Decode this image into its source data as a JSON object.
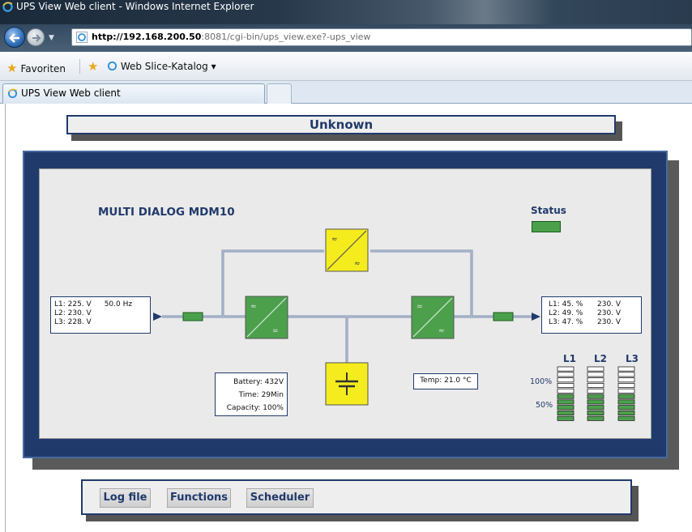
{
  "browser": {
    "window_title": "UPS View Web client - Windows Internet Explorer",
    "url_host": "http://192.168.200.50",
    "url_rest": ":8081/cgi-bin/ups_view.exe?-ups_view",
    "favorites_label": "Favoriten",
    "web_slice_label": "Web Slice-Katalog ▾",
    "tab_label": "UPS View Web client"
  },
  "page": {
    "status_header": "Unknown",
    "model": "MULTI DIALOG MDM10",
    "status_label": "Status",
    "status_color": "#4ca04c",
    "input": {
      "l1": "L1: 225. V",
      "freq": "50.0 Hz",
      "l2": "L2: 230. V",
      "l3": "L3: 228. V"
    },
    "output": [
      {
        "load": "L1:  45. %",
        "volt": "230. V"
      },
      {
        "load": "L2:  49. %",
        "volt": "230. V"
      },
      {
        "load": "L3:  47. %",
        "volt": "230. V"
      }
    ],
    "battery": {
      "battery": "Battery:  432V",
      "time": "Time: 29Min",
      "capacity": "Capacity:  100%"
    },
    "temp": "Temp: 21.0 °C",
    "load_bars": {
      "headers": [
        "L1",
        "L2",
        "L3"
      ],
      "pct_100": "100%",
      "pct_50": "50%",
      "load_fraction": [
        0.45,
        0.49,
        0.47
      ]
    },
    "buttons": {
      "log": "Log file",
      "functions": "Functions",
      "scheduler": "Scheduler"
    }
  }
}
